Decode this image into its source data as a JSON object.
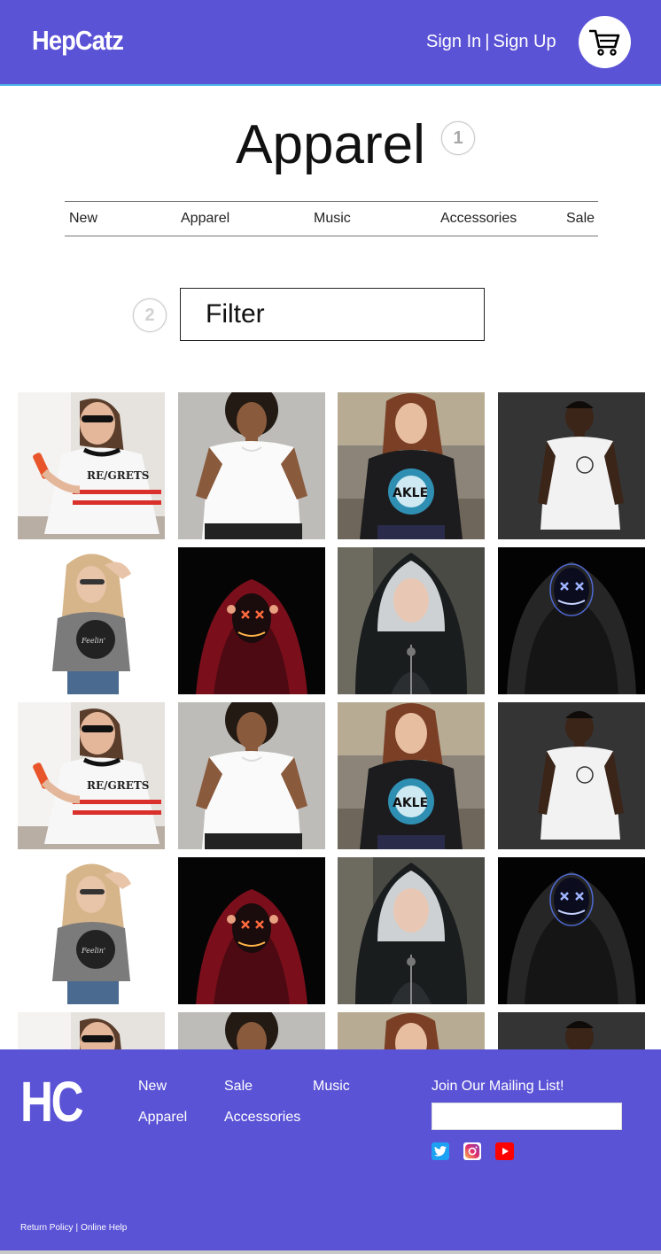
{
  "header": {
    "logo": "HepCatz",
    "sign_in": "Sign In",
    "separator": "|",
    "sign_up": "Sign Up",
    "cart_icon": "shopping-cart-icon",
    "background": "#5b53d6"
  },
  "main": {
    "title": "Apparel",
    "annotation_1": "1",
    "annotation_2": "2",
    "nav": [
      "New",
      "Apparel",
      "Music",
      "Accessories",
      "Sale"
    ],
    "filter_label": "Filter"
  },
  "products": {
    "items": [
      {
        "image": "woman-sunglasses-phone-tee"
      },
      {
        "image": "woman-white-tee"
      },
      {
        "image": "woman-black-graphic-tee"
      },
      {
        "image": "man-white-tee-dark"
      },
      {
        "image": "woman-grey-graphic-tee"
      },
      {
        "image": "neon-mask-red-hoodie"
      },
      {
        "image": "woman-black-hoodie"
      },
      {
        "image": "neon-mask-black-hoodie"
      }
    ]
  },
  "footer": {
    "logo": "HC",
    "links": [
      "New",
      "Sale",
      "Music",
      "Apparel",
      "Accessories"
    ],
    "mailing_label": "Join Our Mailing List!",
    "social": [
      {
        "icon": "twitter-icon",
        "color": "#1da1f2"
      },
      {
        "icon": "instagram-icon",
        "color": "#e1306c"
      },
      {
        "icon": "youtube-icon",
        "color": "#ff0000"
      }
    ],
    "return_policy": "Return Policy",
    "legal_separator": "|",
    "online_help": "Online Help"
  }
}
